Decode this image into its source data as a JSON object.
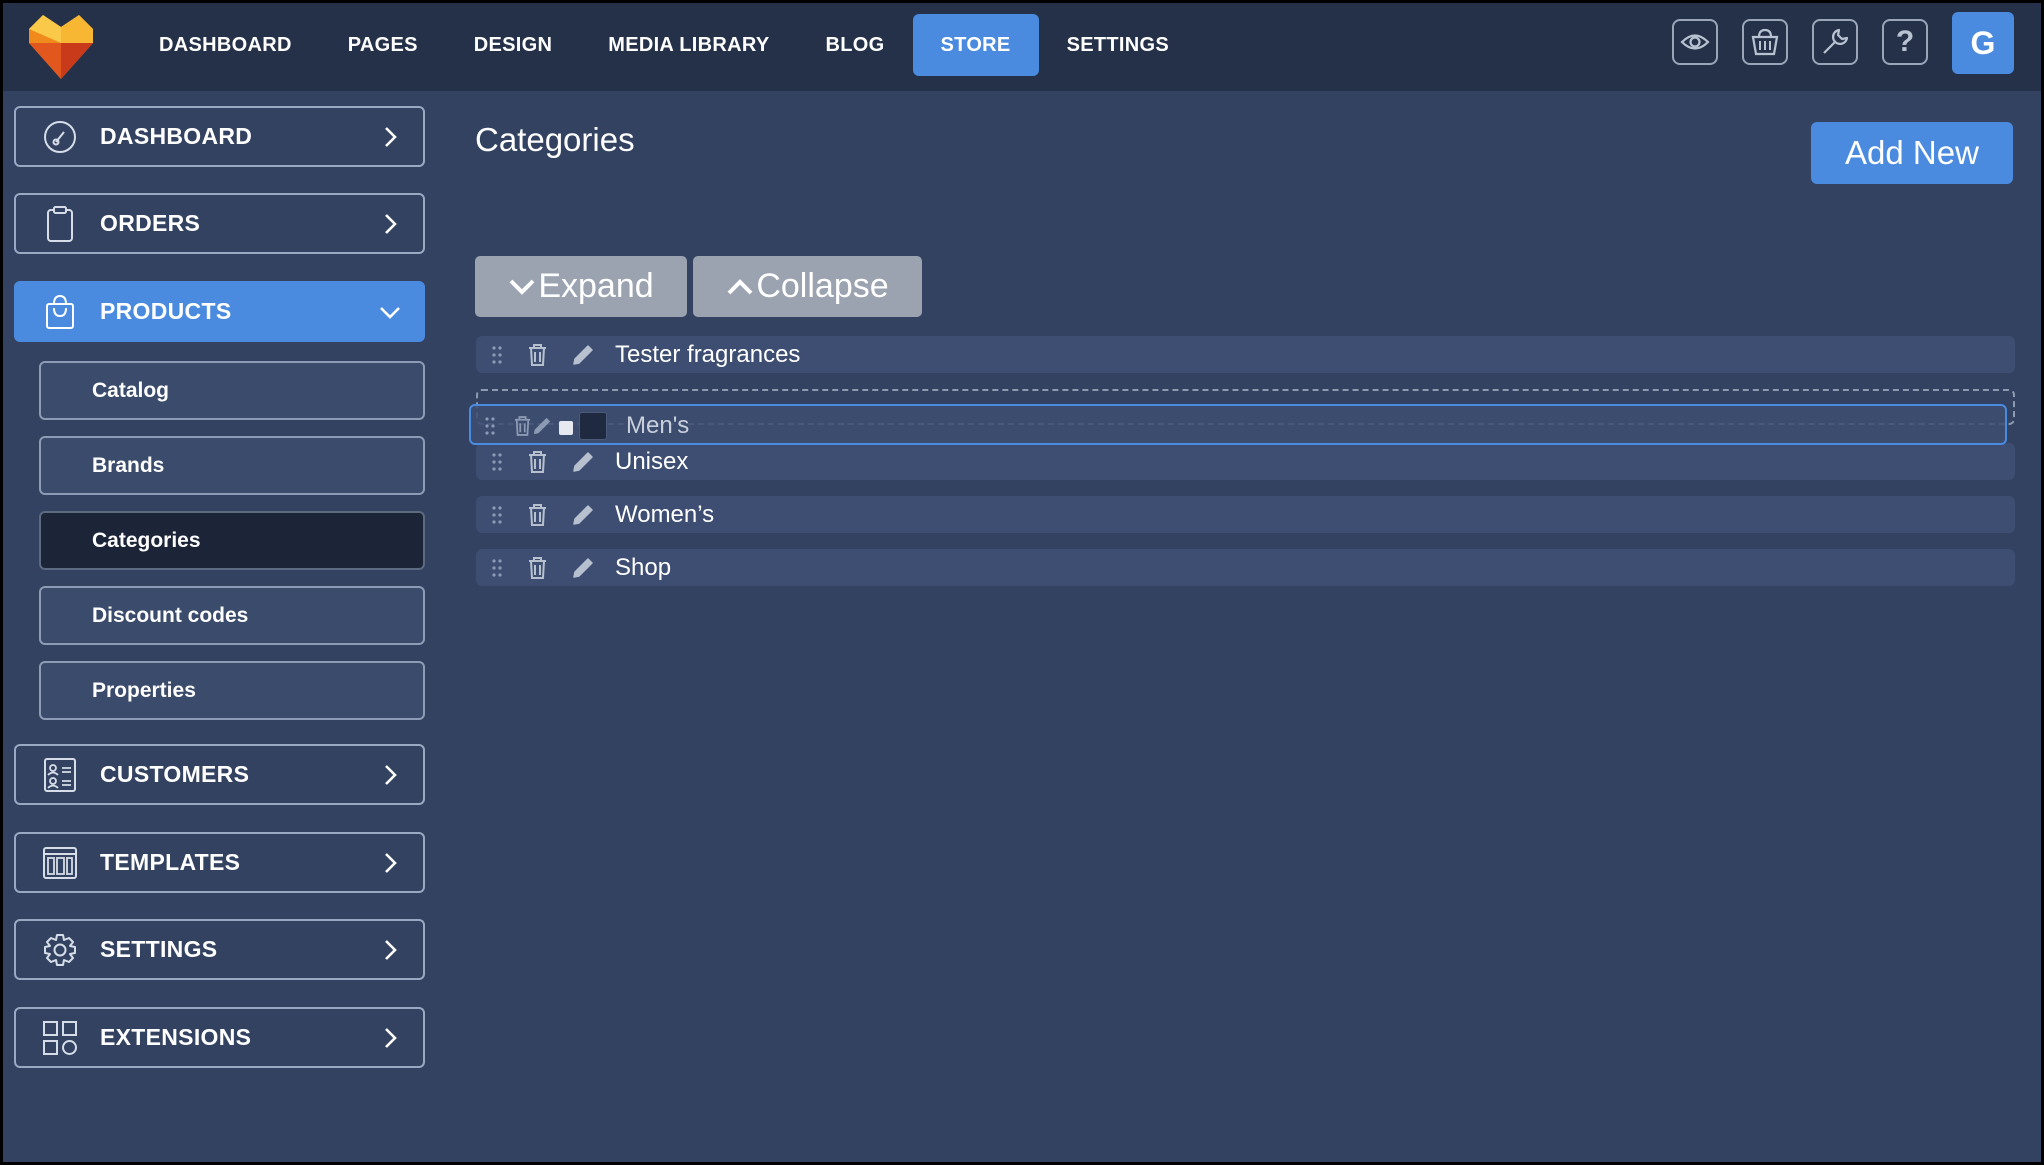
{
  "topnav": {
    "items": [
      "DASHBOARD",
      "PAGES",
      "DESIGN",
      "MEDIA LIBRARY",
      "BLOG",
      "STORE",
      "SETTINGS"
    ],
    "active": "STORE",
    "avatar_letter": "G",
    "icons": [
      "eye-icon",
      "basket-icon",
      "wrench-icon",
      "question-icon"
    ]
  },
  "sidebar": {
    "dashboard": "DASHBOARD",
    "orders": "ORDERS",
    "products": "PRODUCTS",
    "products_sub": [
      "Catalog",
      "Brands",
      "Categories",
      "Discount codes",
      "Properties"
    ],
    "current_sub": "Categories",
    "customers": "CUSTOMERS",
    "templates": "TEMPLATES",
    "settings": "SETTINGS",
    "extensions": "EXTENSIONS"
  },
  "main": {
    "title": "Categories",
    "add_button": "Add New",
    "expand": "Expand",
    "collapse": "Collapse",
    "dragging_item": "Men's",
    "categories": [
      "Tester fragrances",
      "Unisex",
      "Women’s",
      "Shop"
    ]
  },
  "colors": {
    "accent": "#4a8be0",
    "background": "#324260",
    "topbar": "#243148",
    "row": "#3d4e72"
  }
}
